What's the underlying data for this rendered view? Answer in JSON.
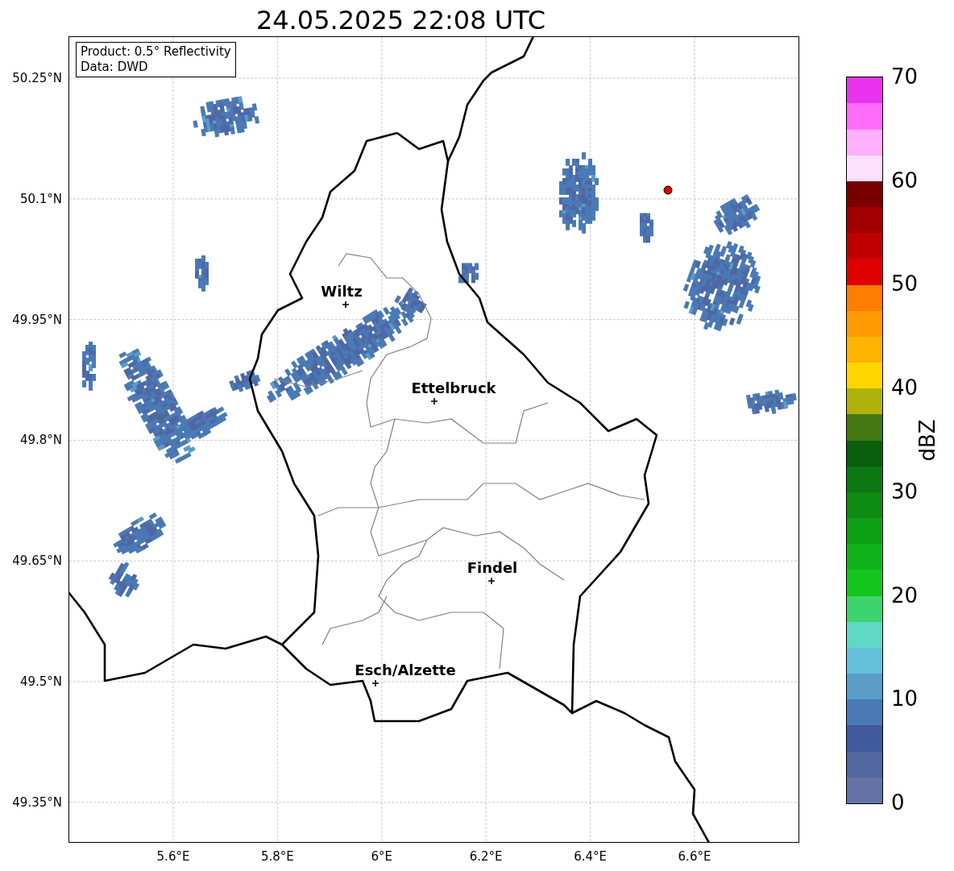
{
  "title": "24.05.2025 22:08 UTC",
  "info_box": {
    "lines": [
      "Product: 0.5° Reflectivity",
      "Data: DWD"
    ]
  },
  "map": {
    "y_ticks": [
      "50.25°N",
      "50.1°N",
      "49.95°N",
      "49.8°N",
      "49.65°N",
      "49.5°N",
      "49.35°N"
    ],
    "x_ticks": [
      "5.6°E",
      "5.8°E",
      "6°E",
      "6.2°E",
      "6.4°E",
      "6.6°E"
    ],
    "cities": [
      {
        "name": "Wiltz"
      },
      {
        "name": "Ettelbruck"
      },
      {
        "name": "Findel"
      },
      {
        "name": "Esch/Alzette"
      }
    ]
  },
  "colorbar": {
    "label": "dBZ",
    "ticks": [
      "70",
      "60",
      "50",
      "40",
      "30",
      "20",
      "10",
      "0"
    ],
    "bins": [
      {
        "color": "#6373a6"
      },
      {
        "color": "#52679e"
      },
      {
        "color": "#41599d"
      },
      {
        "color": "#4a7ab5"
      },
      {
        "color": "#5a9dc8"
      },
      {
        "color": "#65c0db"
      },
      {
        "color": "#5fd8c8"
      },
      {
        "color": "#3dd46e"
      },
      {
        "color": "#12c61b"
      },
      {
        "color": "#10b41a"
      },
      {
        "color": "#0ea014"
      },
      {
        "color": "#0d8c14"
      },
      {
        "color": "#0b7712"
      },
      {
        "color": "#095e0e"
      },
      {
        "color": "#457812"
      },
      {
        "color": "#b0b10a"
      },
      {
        "color": "#ffd600"
      },
      {
        "color": "#ffb400"
      },
      {
        "color": "#ff9a00"
      },
      {
        "color": "#ff7d00"
      },
      {
        "color": "#e00000"
      },
      {
        "color": "#c00000"
      },
      {
        "color": "#a00000"
      },
      {
        "color": "#7a0000"
      },
      {
        "color": "#ffe0fc"
      },
      {
        "color": "#ffb0fc"
      },
      {
        "color": "#ff6cfa"
      },
      {
        "color": "#e933ee"
      }
    ]
  }
}
